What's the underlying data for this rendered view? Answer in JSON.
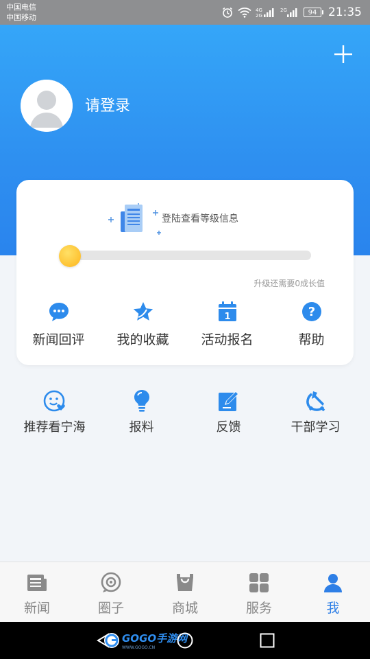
{
  "status_bar": {
    "carrier1": "中国电信",
    "carrier2": "中国移动",
    "battery": "94",
    "time": "21:35"
  },
  "profile": {
    "login_label": "请登录"
  },
  "level_card": {
    "info_text": "登陆查看等级信息",
    "progress": 0,
    "hint": "升级还需要0成长值",
    "menu": [
      {
        "icon": "comment-icon",
        "label": "新闻回评"
      },
      {
        "icon": "star-icon",
        "label": "我的收藏"
      },
      {
        "icon": "calendar-icon",
        "label": "活动报名"
      },
      {
        "icon": "help-icon",
        "label": "帮助"
      }
    ]
  },
  "services": [
    {
      "icon": "smile-heart-icon",
      "label": "推荐看宁海"
    },
    {
      "icon": "lightbulb-icon",
      "label": "报料"
    },
    {
      "icon": "edit-icon",
      "label": "反馈"
    },
    {
      "icon": "party-emblem-icon",
      "label": "干部学习"
    }
  ],
  "tab_bar": {
    "tabs": [
      {
        "icon": "news-icon",
        "label": "新闻",
        "active": false
      },
      {
        "icon": "circle-chat-icon",
        "label": "圈子",
        "active": false
      },
      {
        "icon": "shopping-bag-icon",
        "label": "商城",
        "active": false
      },
      {
        "icon": "grid-icon",
        "label": "服务",
        "active": false
      },
      {
        "icon": "user-icon",
        "label": "我",
        "active": true
      }
    ]
  },
  "watermark": {
    "logo_text": "GOGO手游网",
    "logo_sub": "WWW.GOGO.CN"
  },
  "colors": {
    "header_blue": "#2e8ff0",
    "accent_blue": "#2e7fe6",
    "knob_yellow": "#fdb51b"
  }
}
